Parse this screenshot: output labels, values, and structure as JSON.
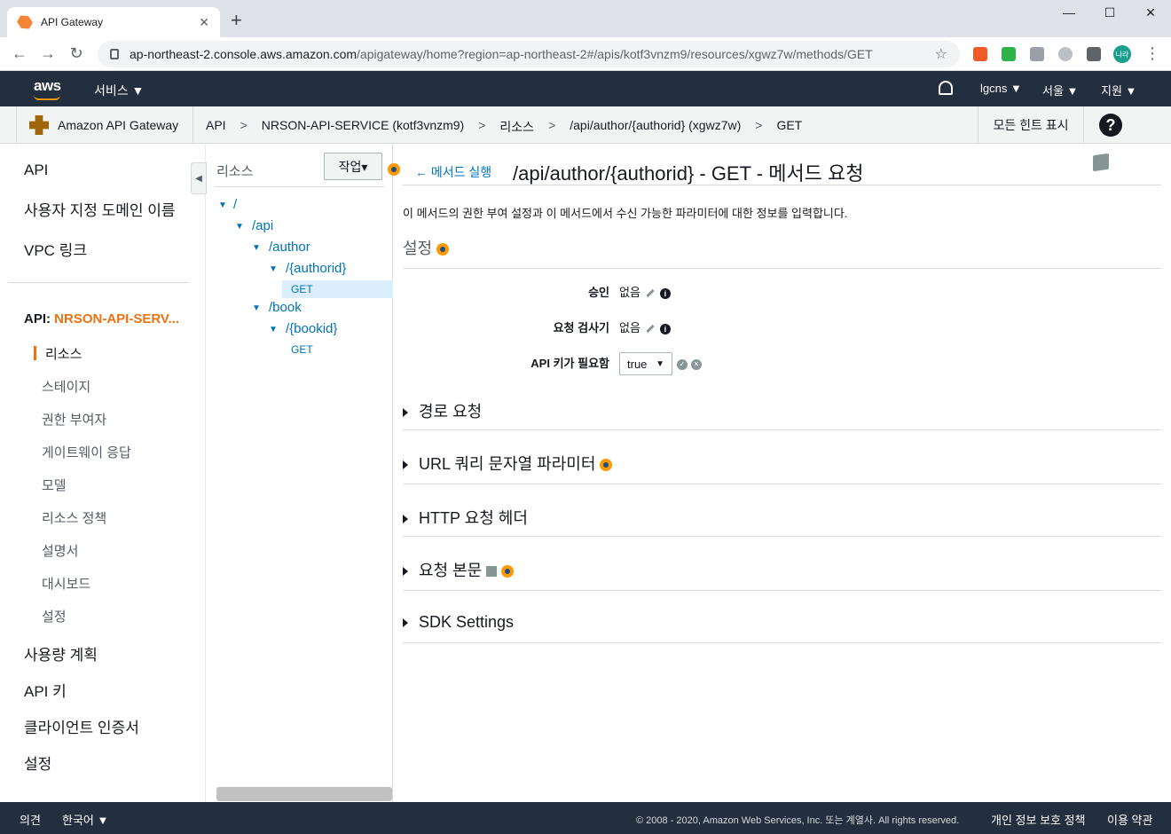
{
  "browser": {
    "tab_title": "API Gateway",
    "url_host": "ap-northeast-2.console.aws.amazon.com",
    "url_path": "/apigateway/home?region=ap-northeast-2#/apis/kotf3vnzm9/resources/xgwz7w/methods/GET",
    "profile_label": "나라"
  },
  "aws_nav": {
    "logo": "aws",
    "services": "서비스 ▼",
    "user": "lgcns ▼",
    "region": "서울 ▼",
    "support": "지원 ▼"
  },
  "breadcrumb": {
    "service": "Amazon API Gateway",
    "items": [
      "API",
      "NRSON-API-SERVICE (kotf3vnzm9)",
      "리소스",
      "/api/author/{authorid} (xgwz7w)",
      "GET"
    ],
    "separator": ">",
    "hints": "모든 힌트 표시"
  },
  "sidebar": {
    "top": [
      "API",
      "사용자 지정 도메인 이름",
      "VPC 링크"
    ],
    "api_prefix": "API: ",
    "api_name": "NRSON-API-SERV...",
    "active": "리소스",
    "subs": [
      "스테이지",
      "권한 부여자",
      "게이트웨이 응답",
      "모델",
      "리소스 정책",
      "설명서",
      "대시보드",
      "설정"
    ],
    "bottom": [
      "사용량 계획",
      "API 키",
      "클라이언트 인증서",
      "설정"
    ]
  },
  "tree": {
    "title": "리소스",
    "actions": "작업▾",
    "nodes": [
      "/",
      "/api",
      "/author",
      "/{authorid}",
      "GET",
      "/book",
      "/{bookid}",
      "GET"
    ]
  },
  "main": {
    "back": "메서드 실행",
    "title": "/api/author/{authorid} - GET - 메서드 요청",
    "description": "이 메서드의 권한 부여 설정과 이 메서드에서 수신 가능한 파라미터에 대한 정보를 입력합니다.",
    "settings": "설정",
    "fields": {
      "auth_label": "승인",
      "auth_value": "없음",
      "validator_label": "요청 검사기",
      "validator_value": "없음",
      "apikey_label": "API 키가 필요함",
      "apikey_value": "true"
    },
    "sections": [
      "경로 요청",
      "URL 쿼리 문자열 파라미터",
      "HTTP 요청 헤더",
      "요청 본문",
      "SDK Settings"
    ]
  },
  "footer": {
    "feedback": "의견",
    "language": "한국어 ▼",
    "copyright": "© 2008 - 2020, Amazon Web Services, Inc. 또는 계열사. All rights reserved.",
    "privacy": "개인 정보 보호 정책",
    "terms": "이용 약관"
  },
  "colors": {
    "aws_nav": "#232f3e",
    "accent_orange": "#ec7211",
    "link_blue": "#0073bb"
  }
}
